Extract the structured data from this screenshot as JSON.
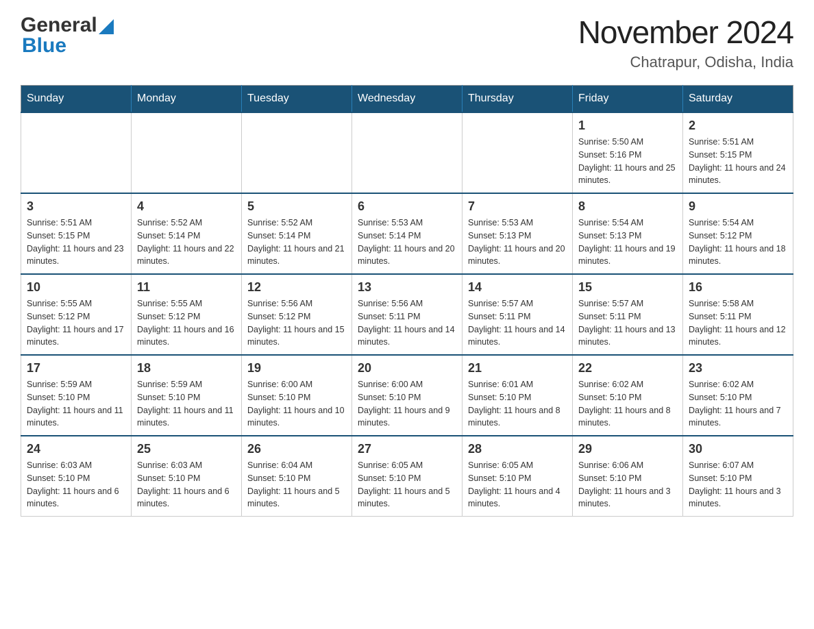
{
  "header": {
    "logo": {
      "general": "General",
      "blue": "Blue"
    },
    "month": "November 2024",
    "location": "Chatrapur, Odisha, India"
  },
  "weekdays": [
    "Sunday",
    "Monday",
    "Tuesday",
    "Wednesday",
    "Thursday",
    "Friday",
    "Saturday"
  ],
  "weeks": [
    [
      {
        "day": "",
        "sunrise": "",
        "sunset": "",
        "daylight": ""
      },
      {
        "day": "",
        "sunrise": "",
        "sunset": "",
        "daylight": ""
      },
      {
        "day": "",
        "sunrise": "",
        "sunset": "",
        "daylight": ""
      },
      {
        "day": "",
        "sunrise": "",
        "sunset": "",
        "daylight": ""
      },
      {
        "day": "",
        "sunrise": "",
        "sunset": "",
        "daylight": ""
      },
      {
        "day": "1",
        "sunrise": "Sunrise: 5:50 AM",
        "sunset": "Sunset: 5:16 PM",
        "daylight": "Daylight: 11 hours and 25 minutes."
      },
      {
        "day": "2",
        "sunrise": "Sunrise: 5:51 AM",
        "sunset": "Sunset: 5:15 PM",
        "daylight": "Daylight: 11 hours and 24 minutes."
      }
    ],
    [
      {
        "day": "3",
        "sunrise": "Sunrise: 5:51 AM",
        "sunset": "Sunset: 5:15 PM",
        "daylight": "Daylight: 11 hours and 23 minutes."
      },
      {
        "day": "4",
        "sunrise": "Sunrise: 5:52 AM",
        "sunset": "Sunset: 5:14 PM",
        "daylight": "Daylight: 11 hours and 22 minutes."
      },
      {
        "day": "5",
        "sunrise": "Sunrise: 5:52 AM",
        "sunset": "Sunset: 5:14 PM",
        "daylight": "Daylight: 11 hours and 21 minutes."
      },
      {
        "day": "6",
        "sunrise": "Sunrise: 5:53 AM",
        "sunset": "Sunset: 5:14 PM",
        "daylight": "Daylight: 11 hours and 20 minutes."
      },
      {
        "day": "7",
        "sunrise": "Sunrise: 5:53 AM",
        "sunset": "Sunset: 5:13 PM",
        "daylight": "Daylight: 11 hours and 20 minutes."
      },
      {
        "day": "8",
        "sunrise": "Sunrise: 5:54 AM",
        "sunset": "Sunset: 5:13 PM",
        "daylight": "Daylight: 11 hours and 19 minutes."
      },
      {
        "day": "9",
        "sunrise": "Sunrise: 5:54 AM",
        "sunset": "Sunset: 5:12 PM",
        "daylight": "Daylight: 11 hours and 18 minutes."
      }
    ],
    [
      {
        "day": "10",
        "sunrise": "Sunrise: 5:55 AM",
        "sunset": "Sunset: 5:12 PM",
        "daylight": "Daylight: 11 hours and 17 minutes."
      },
      {
        "day": "11",
        "sunrise": "Sunrise: 5:55 AM",
        "sunset": "Sunset: 5:12 PM",
        "daylight": "Daylight: 11 hours and 16 minutes."
      },
      {
        "day": "12",
        "sunrise": "Sunrise: 5:56 AM",
        "sunset": "Sunset: 5:12 PM",
        "daylight": "Daylight: 11 hours and 15 minutes."
      },
      {
        "day": "13",
        "sunrise": "Sunrise: 5:56 AM",
        "sunset": "Sunset: 5:11 PM",
        "daylight": "Daylight: 11 hours and 14 minutes."
      },
      {
        "day": "14",
        "sunrise": "Sunrise: 5:57 AM",
        "sunset": "Sunset: 5:11 PM",
        "daylight": "Daylight: 11 hours and 14 minutes."
      },
      {
        "day": "15",
        "sunrise": "Sunrise: 5:57 AM",
        "sunset": "Sunset: 5:11 PM",
        "daylight": "Daylight: 11 hours and 13 minutes."
      },
      {
        "day": "16",
        "sunrise": "Sunrise: 5:58 AM",
        "sunset": "Sunset: 5:11 PM",
        "daylight": "Daylight: 11 hours and 12 minutes."
      }
    ],
    [
      {
        "day": "17",
        "sunrise": "Sunrise: 5:59 AM",
        "sunset": "Sunset: 5:10 PM",
        "daylight": "Daylight: 11 hours and 11 minutes."
      },
      {
        "day": "18",
        "sunrise": "Sunrise: 5:59 AM",
        "sunset": "Sunset: 5:10 PM",
        "daylight": "Daylight: 11 hours and 11 minutes."
      },
      {
        "day": "19",
        "sunrise": "Sunrise: 6:00 AM",
        "sunset": "Sunset: 5:10 PM",
        "daylight": "Daylight: 11 hours and 10 minutes."
      },
      {
        "day": "20",
        "sunrise": "Sunrise: 6:00 AM",
        "sunset": "Sunset: 5:10 PM",
        "daylight": "Daylight: 11 hours and 9 minutes."
      },
      {
        "day": "21",
        "sunrise": "Sunrise: 6:01 AM",
        "sunset": "Sunset: 5:10 PM",
        "daylight": "Daylight: 11 hours and 8 minutes."
      },
      {
        "day": "22",
        "sunrise": "Sunrise: 6:02 AM",
        "sunset": "Sunset: 5:10 PM",
        "daylight": "Daylight: 11 hours and 8 minutes."
      },
      {
        "day": "23",
        "sunrise": "Sunrise: 6:02 AM",
        "sunset": "Sunset: 5:10 PM",
        "daylight": "Daylight: 11 hours and 7 minutes."
      }
    ],
    [
      {
        "day": "24",
        "sunrise": "Sunrise: 6:03 AM",
        "sunset": "Sunset: 5:10 PM",
        "daylight": "Daylight: 11 hours and 6 minutes."
      },
      {
        "day": "25",
        "sunrise": "Sunrise: 6:03 AM",
        "sunset": "Sunset: 5:10 PM",
        "daylight": "Daylight: 11 hours and 6 minutes."
      },
      {
        "day": "26",
        "sunrise": "Sunrise: 6:04 AM",
        "sunset": "Sunset: 5:10 PM",
        "daylight": "Daylight: 11 hours and 5 minutes."
      },
      {
        "day": "27",
        "sunrise": "Sunrise: 6:05 AM",
        "sunset": "Sunset: 5:10 PM",
        "daylight": "Daylight: 11 hours and 5 minutes."
      },
      {
        "day": "28",
        "sunrise": "Sunrise: 6:05 AM",
        "sunset": "Sunset: 5:10 PM",
        "daylight": "Daylight: 11 hours and 4 minutes."
      },
      {
        "day": "29",
        "sunrise": "Sunrise: 6:06 AM",
        "sunset": "Sunset: 5:10 PM",
        "daylight": "Daylight: 11 hours and 3 minutes."
      },
      {
        "day": "30",
        "sunrise": "Sunrise: 6:07 AM",
        "sunset": "Sunset: 5:10 PM",
        "daylight": "Daylight: 11 hours and 3 minutes."
      }
    ]
  ]
}
